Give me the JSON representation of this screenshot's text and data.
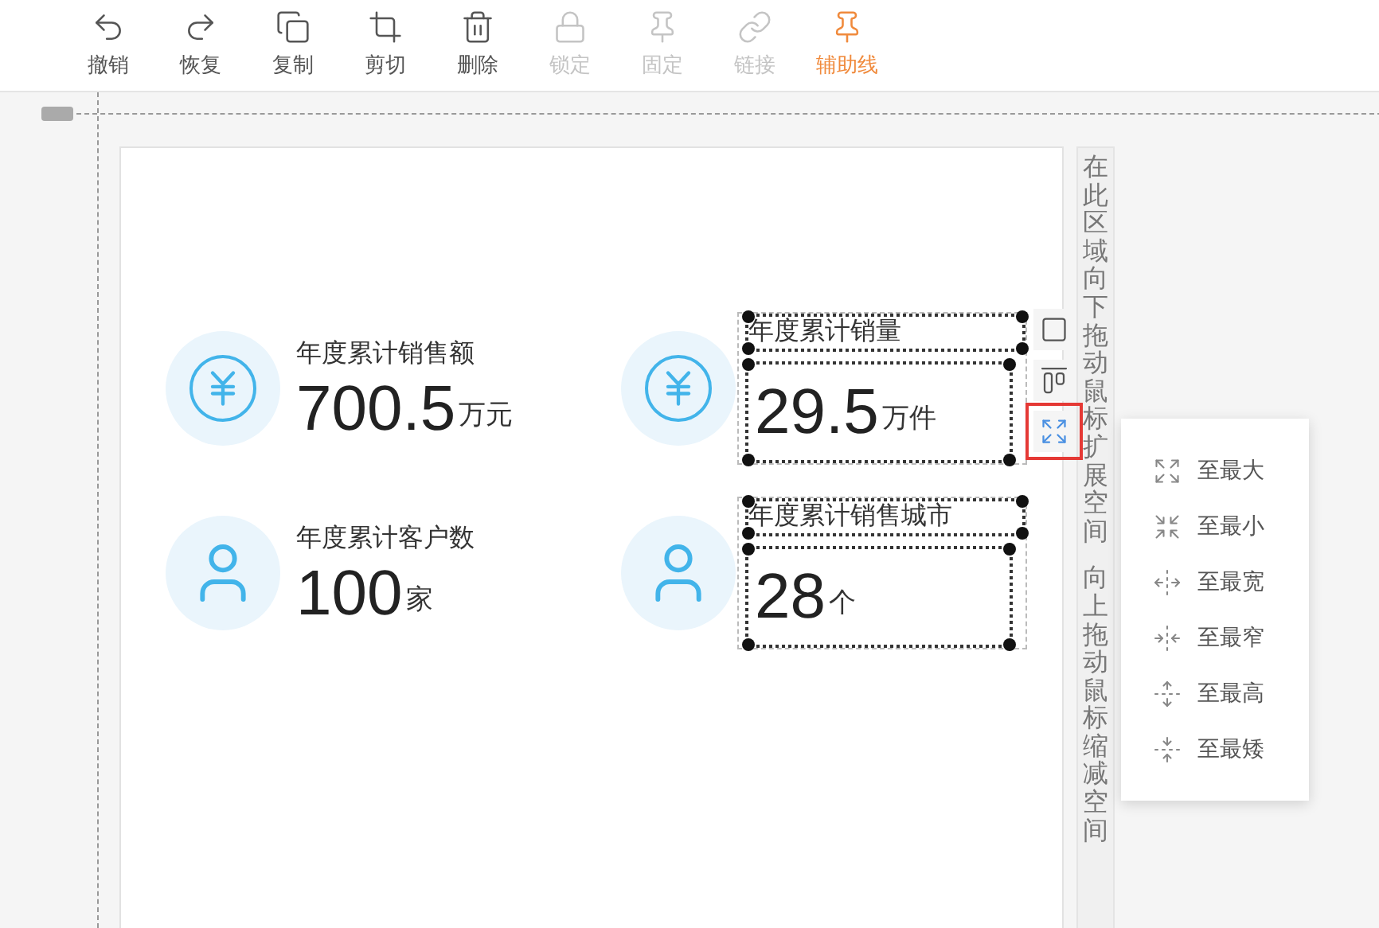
{
  "toolbar": [
    {
      "kind": "undo",
      "label": "撤销",
      "disabled": false,
      "active": false
    },
    {
      "kind": "redo",
      "label": "恢复",
      "disabled": false,
      "active": false
    },
    {
      "kind": "copy",
      "label": "复制",
      "disabled": false,
      "active": false
    },
    {
      "kind": "crop",
      "label": "剪切",
      "disabled": false,
      "active": false
    },
    {
      "kind": "delete",
      "label": "删除",
      "disabled": false,
      "active": false
    },
    {
      "kind": "lock",
      "label": "锁定",
      "disabled": true,
      "active": false
    },
    {
      "kind": "pin",
      "label": "固定",
      "disabled": true,
      "active": false
    },
    {
      "kind": "link",
      "label": "链接",
      "disabled": true,
      "active": false
    },
    {
      "kind": "guide",
      "label": "辅助线",
      "disabled": false,
      "active": true
    }
  ],
  "stats": [
    {
      "kind": "money",
      "title": "年度累计销售额",
      "value": "700.5",
      "unit": "万元",
      "selected": false
    },
    {
      "kind": "money",
      "title": "年度累计销量",
      "value": "29.5",
      "unit": "万件",
      "selected": true
    },
    {
      "kind": "person",
      "title": "年度累计客户数",
      "value": "100",
      "unit": "家",
      "selected": false
    },
    {
      "kind": "person",
      "title": "年度累计销售城市",
      "value": "28",
      "unit": "个",
      "selected": true
    }
  ],
  "side_tools": [
    {
      "kind": "frame",
      "selected": false
    },
    {
      "kind": "align",
      "selected": false
    },
    {
      "kind": "resize",
      "selected": true
    }
  ],
  "resize_menu": [
    {
      "kind": "max",
      "label": "至最大"
    },
    {
      "kind": "min",
      "label": "至最小"
    },
    {
      "kind": "widest",
      "label": "至最宽"
    },
    {
      "kind": "narrowest",
      "label": "至最窄"
    },
    {
      "kind": "tallest",
      "label": "至最高"
    },
    {
      "kind": "shortest",
      "label": "至最矮"
    }
  ],
  "drag_hint": [
    "在此区域向下拖动鼠标扩展空间",
    "向上拖动鼠标缩减空间"
  ]
}
